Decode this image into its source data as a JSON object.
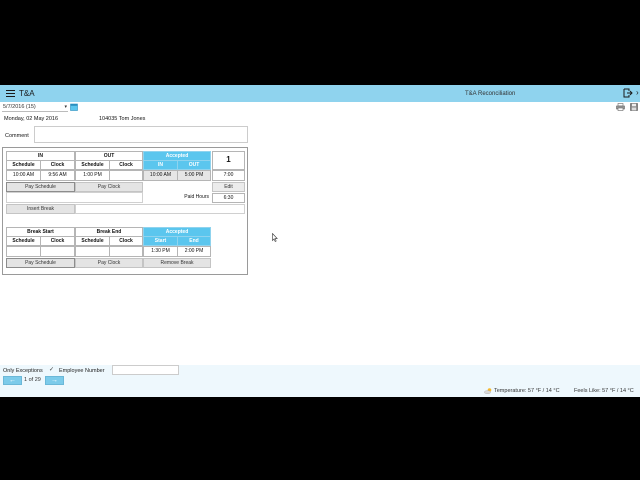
{
  "app": {
    "title": "T&A",
    "page_heading": "T&A Reconciliation"
  },
  "toolbar": {
    "date_select_value": "5/7/2016 (15)"
  },
  "record": {
    "date": "Monday, 02 May 2016",
    "employee": "104035 Tom Jones",
    "comment_label": "Comment",
    "comment_value": ""
  },
  "shift_table": {
    "in_header": "IN",
    "out_header": "OUT",
    "accepted_header": "Accepted",
    "day_number": "1",
    "sub_headers": [
      "Schedule",
      "Clock",
      "Schedule",
      "Clock"
    ],
    "accepted_in": "IN",
    "accepted_out": "OUT",
    "in_schedule": "10:00 AM",
    "in_clock": "9:56 AM",
    "out_schedule": "1:00 PM",
    "out_clock": "",
    "accepted_in_value": "10:00 AM",
    "accepted_out_value": "5:00 PM",
    "total": "7:00",
    "pay_schedule_btn": "Pay Schedule",
    "pay_clock_btn": "Pay Clock",
    "edit_btn": "Edit",
    "paid_hours_label": "Paid Hours",
    "paid_hours_value": "6:30",
    "insert_break_btn": "Insert Break"
  },
  "break_table": {
    "break_start_header": "Break Start",
    "break_end_header": "Break End",
    "accepted_header": "Accepted",
    "sub_headers": [
      "Schedule",
      "Clock",
      "Schedule",
      "Clock"
    ],
    "accepted_start": "Start",
    "accepted_end": "End",
    "start_schedule": "",
    "start_clock": "",
    "end_schedule": "",
    "end_clock": "",
    "accepted_start_value": "1:30 PM",
    "accepted_end_value": "2:00 PM",
    "pay_schedule_btn": "Pay Schedule",
    "pay_clock_btn": "Pay Clock",
    "remove_break_btn": "Remove Break"
  },
  "footer": {
    "only_exceptions_label": "Only Exceptions",
    "only_exceptions_checked": true,
    "employee_number_label": "Employee Number",
    "employee_number_value": "",
    "prev_icon": "arrow-left-icon",
    "next_icon": "arrow-right-icon",
    "page_count": "1 of 29",
    "temperature": "Temperature: 57 °F / 14 °C",
    "feels_like": "Feels Like: 57 °F / 14 °C"
  },
  "colors": {
    "header_bar": "#8fd3ee",
    "accepted": "#5bc6ee",
    "footer": "#eef8fd"
  }
}
